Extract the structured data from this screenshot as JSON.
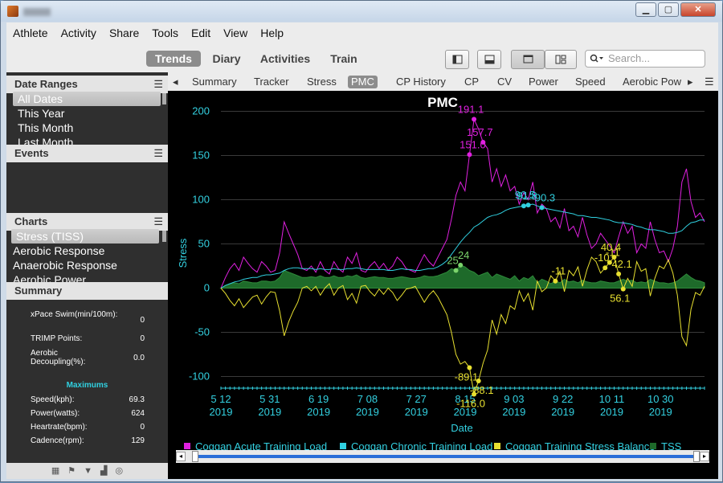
{
  "window": {
    "min": "▁",
    "max": "▢",
    "close": "✕"
  },
  "menu": [
    "Athlete",
    "Activity",
    "Share",
    "Tools",
    "Edit",
    "View",
    "Help"
  ],
  "modes": {
    "trends": "Trends",
    "diary": "Diary",
    "activities": "Activities",
    "train": "Train"
  },
  "search": {
    "placeholder": "Search..."
  },
  "date_ranges": {
    "title": "Date Ranges",
    "items": [
      "All Dates",
      "This Year",
      "This Month",
      "Last Month"
    ]
  },
  "events": {
    "title": "Events"
  },
  "charts": {
    "title": "Charts",
    "items": [
      "Stress (TISS)",
      "Aerobic Response",
      "Anaerobic Response",
      "Aerobic Power"
    ]
  },
  "summary": {
    "title": "Summary",
    "rows": [
      {
        "label": "xPace Swim(min/100m):",
        "value": "0"
      },
      {
        "label": "TRIMP Points:",
        "value": "0"
      },
      {
        "label": "Aerobic Decoupling(%):",
        "value": "0.0"
      }
    ],
    "maximums_title": "Maximums",
    "max_rows": [
      {
        "label": "Speed(kph):",
        "value": "69.3"
      },
      {
        "label": "Power(watts):",
        "value": "624"
      },
      {
        "label": "Heartrate(bpm):",
        "value": "0"
      },
      {
        "label": "Cadence(rpm):",
        "value": "129"
      }
    ]
  },
  "tabs": [
    "Summary",
    "Tracker",
    "Stress",
    "PMC",
    "CP History",
    "CP",
    "CV",
    "Power",
    "Speed",
    "Aerobic Pow"
  ],
  "colors": {
    "atl": "#e020e0",
    "ctl": "#30d0e0",
    "tsb": "#e8e030",
    "tss": "#1e6a2a",
    "axis": "#33d0e0"
  },
  "chart_data": {
    "type": "line",
    "title": "PMC",
    "xlabel": "Date",
    "ylabel": "Stress",
    "ylim": [
      -115,
      205
    ],
    "yticks": [
      "200",
      "150",
      "100",
      "50",
      "0",
      "-50",
      "-100"
    ],
    "xticks": [
      {
        "d": "5 12",
        "y": "2019"
      },
      {
        "d": "5 31",
        "y": "2019"
      },
      {
        "d": "6 19",
        "y": "2019"
      },
      {
        "d": "7 08",
        "y": "2019"
      },
      {
        "d": "7 27",
        "y": "2019"
      },
      {
        "d": "8 15",
        "y": "2019"
      },
      {
        "d": "9 03",
        "y": "2019"
      },
      {
        "d": "9 22",
        "y": "2019"
      },
      {
        "d": "10 11",
        "y": "2019"
      },
      {
        "d": "10 30",
        "y": "2019"
      }
    ],
    "series": [
      {
        "name": "Coggan Acute Training Load",
        "values": [
          0,
          12,
          22,
          28,
          20,
          35,
          28,
          22,
          18,
          30,
          25,
          18,
          20,
          40,
          75,
          62,
          50,
          38,
          22,
          20,
          25,
          18,
          30,
          20,
          16,
          30,
          22,
          18,
          35,
          28,
          40,
          20,
          18,
          25,
          30,
          22,
          28,
          20,
          25,
          35,
          30,
          22,
          20,
          18,
          28,
          38,
          30,
          25,
          35,
          45,
          55,
          78,
          105,
          120,
          110,
          151,
          191,
          180,
          165,
          158,
          120,
          135,
          115,
          128,
          110,
          115,
          95,
          108,
          100,
          120,
          85,
          95,
          90,
          75,
          80,
          68,
          90,
          65,
          70,
          58,
          80,
          60,
          45,
          50,
          62,
          55,
          48,
          40,
          58,
          75,
          62,
          70,
          40,
          50,
          45,
          75,
          55,
          40,
          42,
          30,
          45,
          70,
          120,
          135,
          98,
          80,
          85,
          75
        ]
      },
      {
        "name": "Coggan Chronic Training Load",
        "values": [
          0,
          3,
          5,
          7,
          8,
          10,
          11,
          12,
          12,
          14,
          15,
          15,
          16,
          17,
          20,
          22,
          23,
          23,
          22,
          22,
          22,
          21,
          22,
          21,
          21,
          22,
          21,
          21,
          22,
          22,
          23,
          22,
          21,
          21,
          21,
          21,
          21,
          20,
          20,
          21,
          22,
          21,
          21,
          20,
          20,
          21,
          22,
          22,
          24,
          27,
          31,
          38,
          45,
          52,
          58,
          63,
          69,
          72,
          76,
          80,
          82,
          83,
          85,
          88,
          90,
          91,
          92,
          93,
          94,
          95,
          93,
          91,
          90,
          89,
          88,
          87,
          86,
          85,
          84,
          82,
          82,
          81,
          80,
          80,
          79,
          78,
          77,
          75,
          74,
          74,
          73,
          72,
          70,
          69,
          67,
          66,
          66,
          65,
          64,
          62,
          62,
          63,
          65,
          70,
          74,
          75,
          77,
          77
        ]
      },
      {
        "name": "Coggan Training Stress Balance",
        "values": [
          0,
          -6,
          -14,
          -20,
          -12,
          -22,
          -16,
          -10,
          -8,
          -18,
          -10,
          -4,
          -5,
          -26,
          -54,
          -38,
          -26,
          -16,
          0,
          2,
          -3,
          2,
          -8,
          0,
          5,
          -8,
          0,
          3,
          -13,
          -6,
          -17,
          2,
          3,
          -4,
          -9,
          -1,
          -7,
          0,
          -5,
          -14,
          -8,
          -1,
          0,
          2,
          -7,
          -16,
          -8,
          -3,
          -10,
          -20,
          -30,
          -50,
          -75,
          -86,
          -83,
          -90,
          -120,
          -105,
          -85,
          -70,
          -36,
          -52,
          -30,
          -40,
          -20,
          -24,
          -3,
          -15,
          -6,
          -25,
          8,
          -4,
          0,
          14,
          8,
          19,
          -4,
          20,
          14,
          24,
          2,
          21,
          35,
          30,
          17,
          23,
          29,
          35,
          16,
          -1,
          11,
          2,
          30,
          19,
          22,
          -9,
          11,
          25,
          22,
          32,
          17,
          -8,
          -55,
          -65,
          -24,
          -5,
          -8,
          2
        ]
      },
      {
        "name": "TSS",
        "values": [
          0,
          3,
          5,
          6,
          5,
          8,
          7,
          6,
          6,
          8,
          8,
          7,
          8,
          12,
          20,
          18,
          16,
          14,
          12,
          12,
          13,
          12,
          14,
          12,
          12,
          14,
          12,
          12,
          14,
          13,
          15,
          12,
          11,
          12,
          13,
          12,
          12,
          11,
          11,
          12,
          13,
          12,
          11,
          11,
          12,
          14,
          13,
          13,
          14,
          16,
          18,
          22,
          20,
          26,
          24,
          20,
          18,
          14,
          16,
          18,
          12,
          16,
          14,
          12,
          10,
          14,
          8,
          12,
          10,
          14,
          6,
          10,
          8,
          5,
          8,
          6,
          10,
          7,
          8,
          6,
          9,
          7,
          6,
          6,
          8,
          7,
          6,
          6,
          8,
          10,
          8,
          9,
          6,
          7,
          6,
          10,
          8,
          6,
          6,
          5,
          6,
          8,
          12,
          16,
          12,
          9,
          8,
          6
        ]
      }
    ],
    "point_labels": [
      {
        "text": "191.1",
        "s": 0,
        "i": 56
      },
      {
        "text": "151.0",
        "s": 0,
        "i": 55
      },
      {
        "text": "157.7",
        "s": 0,
        "i": 58
      },
      {
        "text": "91.8",
        "s": 1,
        "i": 67
      },
      {
        "text": "90.5",
        "s": 1,
        "i": 68
      },
      {
        "text": "90.3",
        "s": 1,
        "i": 71
      },
      {
        "text": "25",
        "s": 3,
        "i": 52
      },
      {
        "text": "24",
        "s": 3,
        "i": 53
      },
      {
        "text": "-89.1",
        "s": 2,
        "i": 55
      },
      {
        "text": "-88.1",
        "s": 2,
        "i": 57
      },
      {
        "text": "-116.0",
        "s": 2,
        "i": 56
      },
      {
        "text": "-11",
        "s": 2,
        "i": 74
      },
      {
        "text": "-10",
        "s": 2,
        "i": 85
      },
      {
        "text": "-11",
        "s": 2,
        "i": 86
      },
      {
        "text": "40.4",
        "s": 2,
        "i": 87
      },
      {
        "text": "42.1",
        "s": 2,
        "i": 88
      },
      {
        "text": "56.1",
        "s": 2,
        "i": 89
      }
    ]
  }
}
